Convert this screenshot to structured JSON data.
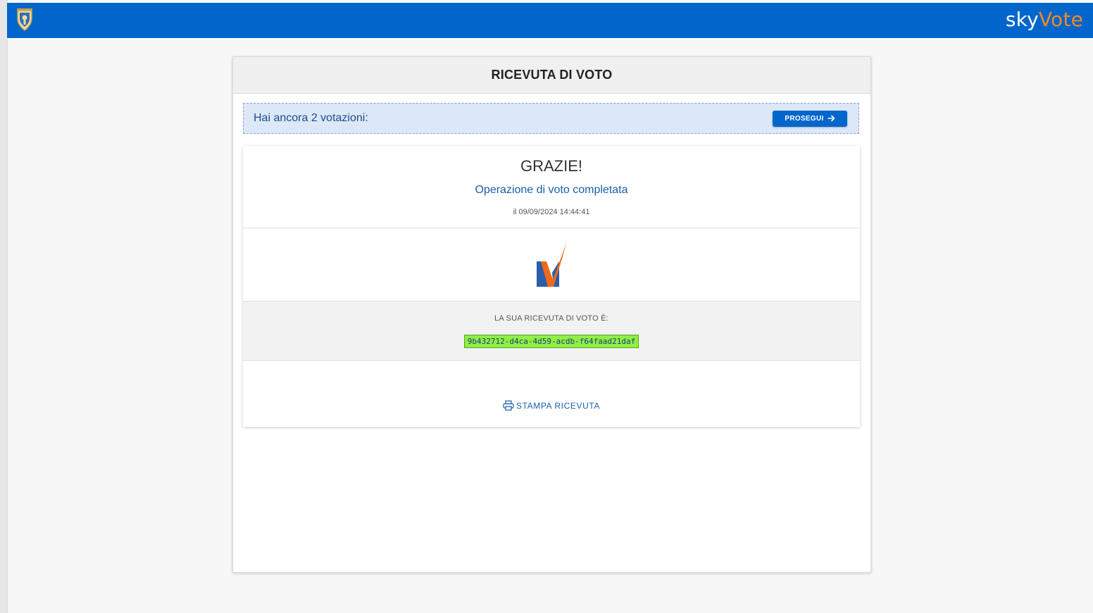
{
  "app": {
    "brand_part1": "sky",
    "brand_part2": "Vote",
    "brand_color": "#0066cc",
    "accent_color": "#f08a24"
  },
  "receipt_card": {
    "title": "RICEVUTA DI VOTO",
    "notice": {
      "text": "Hai ancora 2 votazioni:",
      "button_label": "PROSEGUI",
      "button_icon": "arrow-right-icon"
    },
    "thanks": {
      "title": "GRAZIE!",
      "subtitle": "Operazione di voto completata",
      "date": "il 09/09/2024 14:44:41"
    },
    "logo_icon": "vote-check-logo-icon",
    "receipt": {
      "label": "LA SUA RICEVUTA DI VOTO È:",
      "code": "9b432712-d4ca-4d59-acdb-f64faad21daf"
    },
    "print": {
      "label": "STAMPA RICEVUTA",
      "icon": "printer-icon"
    }
  }
}
